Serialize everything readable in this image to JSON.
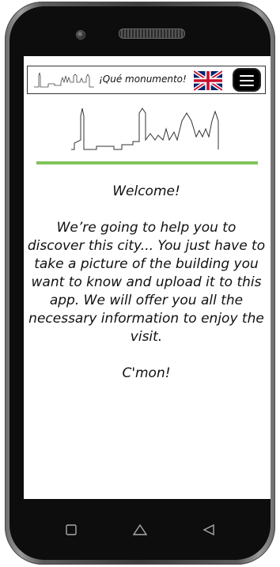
{
  "app": {
    "title": "¡Qué monumento!",
    "language_flag": "uk-flag-icon",
    "menu_icon": "hamburger-menu-icon"
  },
  "main": {
    "welcome": "Welcome!",
    "body": "We’re going to help you to discover this city... You just have to take a picture of the building you want to know and upload it to this app. We will offer you all the necessary information to enjoy the visit.",
    "cta": "C'mon!"
  },
  "colors": {
    "accent_divider": "#80c35a",
    "phone_frame": "#0d0d0d",
    "screen_bg": "#ffffff"
  },
  "navigation": {
    "recent_apps_icon": "square-icon",
    "home_icon": "home-icon",
    "back_icon": "back-triangle-icon"
  }
}
